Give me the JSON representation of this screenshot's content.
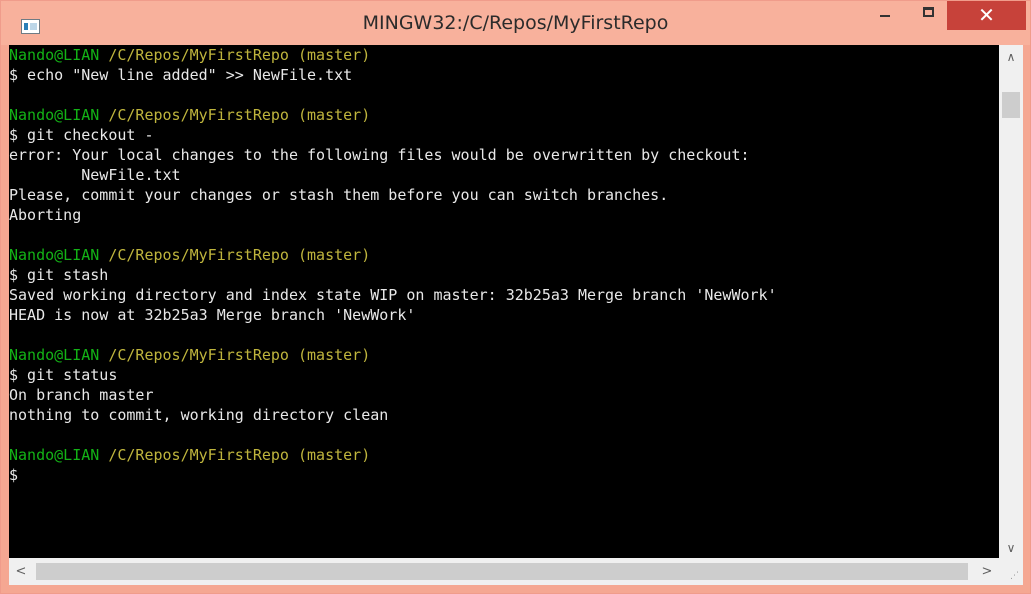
{
  "window": {
    "title": "MINGW32:/C/Repos/MyFirstRepo",
    "close_glyph": "✕",
    "icons": {
      "app": "terminal-icon",
      "minimize": "minimize-icon",
      "maximize": "maximize-icon",
      "close": "close-icon"
    }
  },
  "terminal": {
    "colors": {
      "background": "#000000",
      "user": "#13b316",
      "path": "#bfb53d",
      "text": "#e8e8e8"
    },
    "lines": [
      {
        "segments": [
          {
            "text": "Nando@LIAN",
            "color": "green"
          },
          {
            "text": " /C/Repos/MyFirstRepo (master)",
            "color": "yellow"
          }
        ]
      },
      {
        "segments": [
          {
            "text": "$ echo \"New line added\" >> NewFile.txt",
            "color": "white"
          }
        ]
      },
      {
        "segments": []
      },
      {
        "segments": [
          {
            "text": "Nando@LIAN",
            "color": "green"
          },
          {
            "text": " /C/Repos/MyFirstRepo (master)",
            "color": "yellow"
          }
        ]
      },
      {
        "segments": [
          {
            "text": "$ git checkout -",
            "color": "white"
          }
        ]
      },
      {
        "segments": [
          {
            "text": "error: Your local changes to the following files would be overwritten by checkout:",
            "color": "white"
          }
        ]
      },
      {
        "segments": [
          {
            "text": "        NewFile.txt",
            "color": "white"
          }
        ]
      },
      {
        "segments": [
          {
            "text": "Please, commit your changes or stash them before you can switch branches.",
            "color": "white"
          }
        ]
      },
      {
        "segments": [
          {
            "text": "Aborting",
            "color": "white"
          }
        ]
      },
      {
        "segments": []
      },
      {
        "segments": [
          {
            "text": "Nando@LIAN",
            "color": "green"
          },
          {
            "text": " /C/Repos/MyFirstRepo (master)",
            "color": "yellow"
          }
        ]
      },
      {
        "segments": [
          {
            "text": "$ git stash",
            "color": "white"
          }
        ]
      },
      {
        "segments": [
          {
            "text": "Saved working directory and index state WIP on master: 32b25a3 Merge branch 'NewWork'",
            "color": "white"
          }
        ]
      },
      {
        "segments": [
          {
            "text": "HEAD is now at 32b25a3 Merge branch 'NewWork'",
            "color": "white"
          }
        ]
      },
      {
        "segments": []
      },
      {
        "segments": [
          {
            "text": "Nando@LIAN",
            "color": "green"
          },
          {
            "text": " /C/Repos/MyFirstRepo (master)",
            "color": "yellow"
          }
        ]
      },
      {
        "segments": [
          {
            "text": "$ git status",
            "color": "white"
          }
        ]
      },
      {
        "segments": [
          {
            "text": "On branch master",
            "color": "white"
          }
        ]
      },
      {
        "segments": [
          {
            "text": "nothing to commit, working directory clean",
            "color": "white"
          }
        ]
      },
      {
        "segments": []
      },
      {
        "segments": [
          {
            "text": "Nando@LIAN",
            "color": "green"
          },
          {
            "text": " /C/Repos/MyFirstRepo (master)",
            "color": "yellow"
          }
        ]
      },
      {
        "segments": [
          {
            "text": "$",
            "color": "white"
          }
        ]
      }
    ]
  },
  "scrollbars": {
    "up_glyph": "∧",
    "down_glyph": "∨",
    "left_glyph": "<",
    "right_glyph": ">",
    "icons": {
      "up": "chevron-up-icon",
      "down": "chevron-down-icon",
      "left": "chevron-left-icon",
      "right": "chevron-right-icon",
      "grip": "resize-grip-icon"
    }
  }
}
